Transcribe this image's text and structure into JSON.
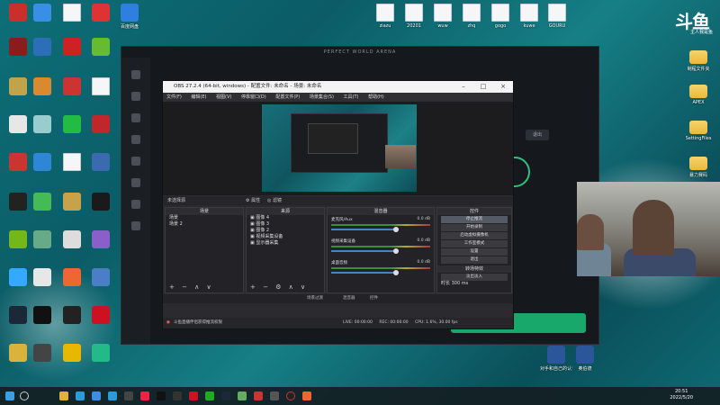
{
  "desktop_icons_left": [
    {
      "label": "",
      "type": "app",
      "color": "#c9302c"
    },
    {
      "label": "",
      "type": "app",
      "color": "#3a8ee6"
    },
    {
      "label": "",
      "type": "file",
      "color": "#f4f6f8"
    },
    {
      "label": "",
      "type": "app",
      "color": "#d33"
    },
    {
      "label": "百度网盘",
      "type": "app",
      "color": "#2f7fe0"
    }
  ],
  "top_files": [
    {
      "label": "ziazu"
    },
    {
      "label": "20201"
    },
    {
      "label": "wuw"
    },
    {
      "label": "zhq"
    },
    {
      "label": "gogo"
    },
    {
      "label": "kuwe"
    },
    {
      "label": "GOURU"
    }
  ],
  "right_icons": [
    {
      "label": "制程文件夹"
    },
    {
      "label": "APEX"
    },
    {
      "label": "SettingFiles"
    },
    {
      "label": "暴力赛码"
    }
  ],
  "bottom_right_files": [
    {
      "label": "对手和自己的认识"
    },
    {
      "label": "奥伯德"
    }
  ],
  "launcher": {
    "title": "PERFECT WORLD ARENA",
    "button_label": "退出"
  },
  "obs": {
    "title": "OBS 27.2.4 (64-bit, windows) - 配置文件: 未命名 - 场景: 未命名",
    "menu": [
      "文件(F)",
      "编辑(E)",
      "视图(V)",
      "停靠窗口(D)",
      "配置文件(P)",
      "场景集合(S)",
      "工具(T)",
      "帮助(H)"
    ],
    "source_bar": {
      "label": "未选择源",
      "props": "属性",
      "filters": "滤镜"
    },
    "docks": {
      "scenes": {
        "header": "场景",
        "items": [
          "场景",
          "场景 2"
        ]
      },
      "sources": {
        "header": "来源",
        "items": [
          "图像 4",
          "图像 3",
          "图像 2",
          "视频采集设备",
          "显示器采集"
        ]
      },
      "mixer": {
        "header": "混音器",
        "channels": [
          {
            "name": "麦克风/Aux",
            "db": "0.0 dB"
          },
          {
            "name": "视频采集设备",
            "db": "0.0 dB"
          },
          {
            "name": "桌面音频",
            "db": "0.0 dB"
          }
        ]
      },
      "controls": {
        "header": "控件",
        "buttons": [
          "停止推流",
          "开始录制",
          "启动虚拟摄像机",
          "工作室模式",
          "设置",
          "退出"
        ],
        "transition_header": "转场特效",
        "transition": "淡出淡入",
        "duration_label": "时长",
        "duration": "300 ms"
      }
    },
    "status": {
      "live": "LIVE: 00:00:00",
      "rec": "REC: 00:00:00",
      "cpu": "CPU: 1.6%, 30.00 fps"
    },
    "footer_tabs": [
      "场景过渡",
      "混音器",
      "控件"
    ],
    "footer_warning": "斗鱼直播伴侣获得推流权限"
  },
  "logo": {
    "text": "斗鱼",
    "sub": "主人我是鱼"
  },
  "clock": {
    "time": "20:51",
    "date": "2022/5/20"
  },
  "taskbar_icons": [
    "#3a8ee6",
    "#e2b13c",
    "#2c9ad6",
    "#333",
    "#d13",
    "#555",
    "#1a9",
    "#2b5",
    "#6a6",
    "#c33",
    "#5a7",
    "#e63",
    "#ec3"
  ]
}
